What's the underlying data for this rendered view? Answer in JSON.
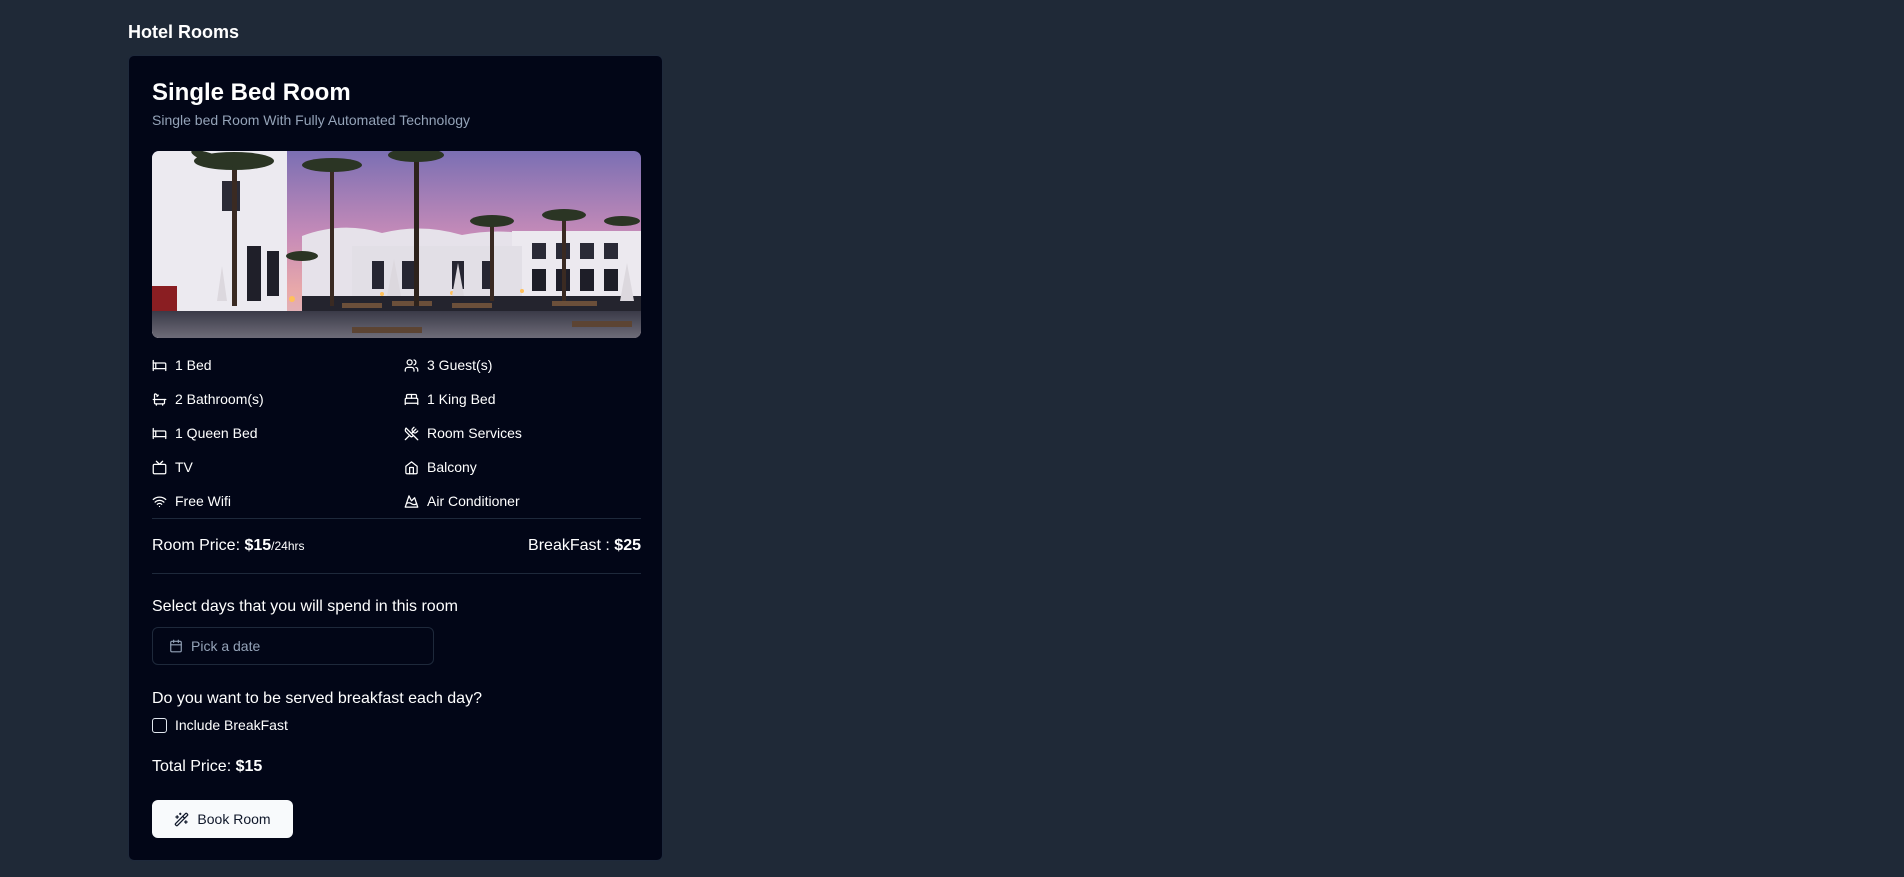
{
  "page": {
    "heading": "Hotel Rooms"
  },
  "room": {
    "title": "Single Bed Room",
    "subtitle": "Single bed Room With Fully Automated Technology",
    "photo_icon": "hotel-pool-photo"
  },
  "amenities": [
    {
      "label": "1 Bed",
      "icon": "bed-icon"
    },
    {
      "label": "3 Guest(s)",
      "icon": "users-icon"
    },
    {
      "label": "2 Bathroom(s)",
      "icon": "bath-icon"
    },
    {
      "label": "1 King Bed",
      "icon": "bed-double-icon"
    },
    {
      "label": "1 Queen Bed",
      "icon": "bed-icon"
    },
    {
      "label": "Room Services",
      "icon": "utensils-crossed-icon"
    },
    {
      "label": "TV",
      "icon": "tv-icon"
    },
    {
      "label": "Balcony",
      "icon": "home-icon"
    },
    {
      "label": "Free Wifi",
      "icon": "wifi-icon"
    },
    {
      "label": "Air Conditioner",
      "icon": "air-conditioner-icon"
    }
  ],
  "pricing": {
    "room_price_label": "Room Price: ",
    "room_price_value": "$15",
    "room_price_unit": "/24hrs",
    "breakfast_label": "BreakFast : ",
    "breakfast_value": "$25"
  },
  "booking": {
    "days_label": "Select days that you will spend in this room",
    "date_placeholder": "Pick a date",
    "breakfast_question": "Do you want to be served breakfast each day?",
    "include_breakfast_label": "Include BreakFast",
    "include_breakfast_checked": false,
    "total_label": "Total Price: ",
    "total_value": "$15",
    "book_button_label": "Book Room"
  },
  "colors": {
    "page_bg": "#1f2937",
    "card_bg": "#020617",
    "border": "#1e293b",
    "muted_text": "#94a3b8",
    "button_bg": "#f8fafc"
  }
}
